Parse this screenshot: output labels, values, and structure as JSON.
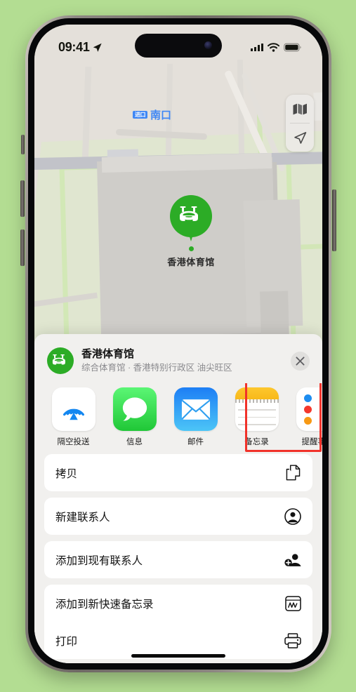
{
  "status_bar": {
    "time": "09:41",
    "location_arrow_icon": "location-arrow-icon",
    "signal_icon": "cellular-signal-icon",
    "signal_bars": 4,
    "wifi_icon": "wifi-icon",
    "battery_icon": "battery-full-icon"
  },
  "map": {
    "label_badge": "进口",
    "label_text": "南口",
    "poi_name": "香港体育馆",
    "poi_icon": "stadium-icon",
    "poi_color": "#2cac26",
    "controls": [
      {
        "name": "map-layers-icon",
        "label": "地图"
      },
      {
        "name": "location-arrow-icon",
        "label": "定位"
      }
    ]
  },
  "share_sheet": {
    "title": "香港体育馆",
    "subtitle": "综合体育馆 · 香港特别行政区 油尖旺区",
    "avatar_icon": "stadium-icon",
    "close_label": "✕",
    "apps": [
      {
        "label": "隔空投送",
        "icon": "airdrop-icon",
        "highlighted": false
      },
      {
        "label": "信息",
        "icon": "messages-icon",
        "highlighted": false
      },
      {
        "label": "邮件",
        "icon": "mail-icon",
        "highlighted": false
      },
      {
        "label": "备忘录",
        "icon": "notes-icon",
        "highlighted": true
      },
      {
        "label": "提醒事项",
        "icon": "reminders-icon",
        "highlighted": false
      }
    ],
    "actions": [
      {
        "label": "拷贝",
        "icon": "copy-documents-icon"
      },
      {
        "label": "新建联系人",
        "icon": "person-circle-icon"
      },
      {
        "label": "添加到现有联系人",
        "icon": "person-badge-plus-icon"
      },
      {
        "label": "添加到新快速备忘录",
        "icon": "quick-note-icon"
      },
      {
        "label": "打印",
        "icon": "printer-icon"
      }
    ]
  },
  "highlight": {
    "color": "#f1322a",
    "target": "备忘录"
  }
}
